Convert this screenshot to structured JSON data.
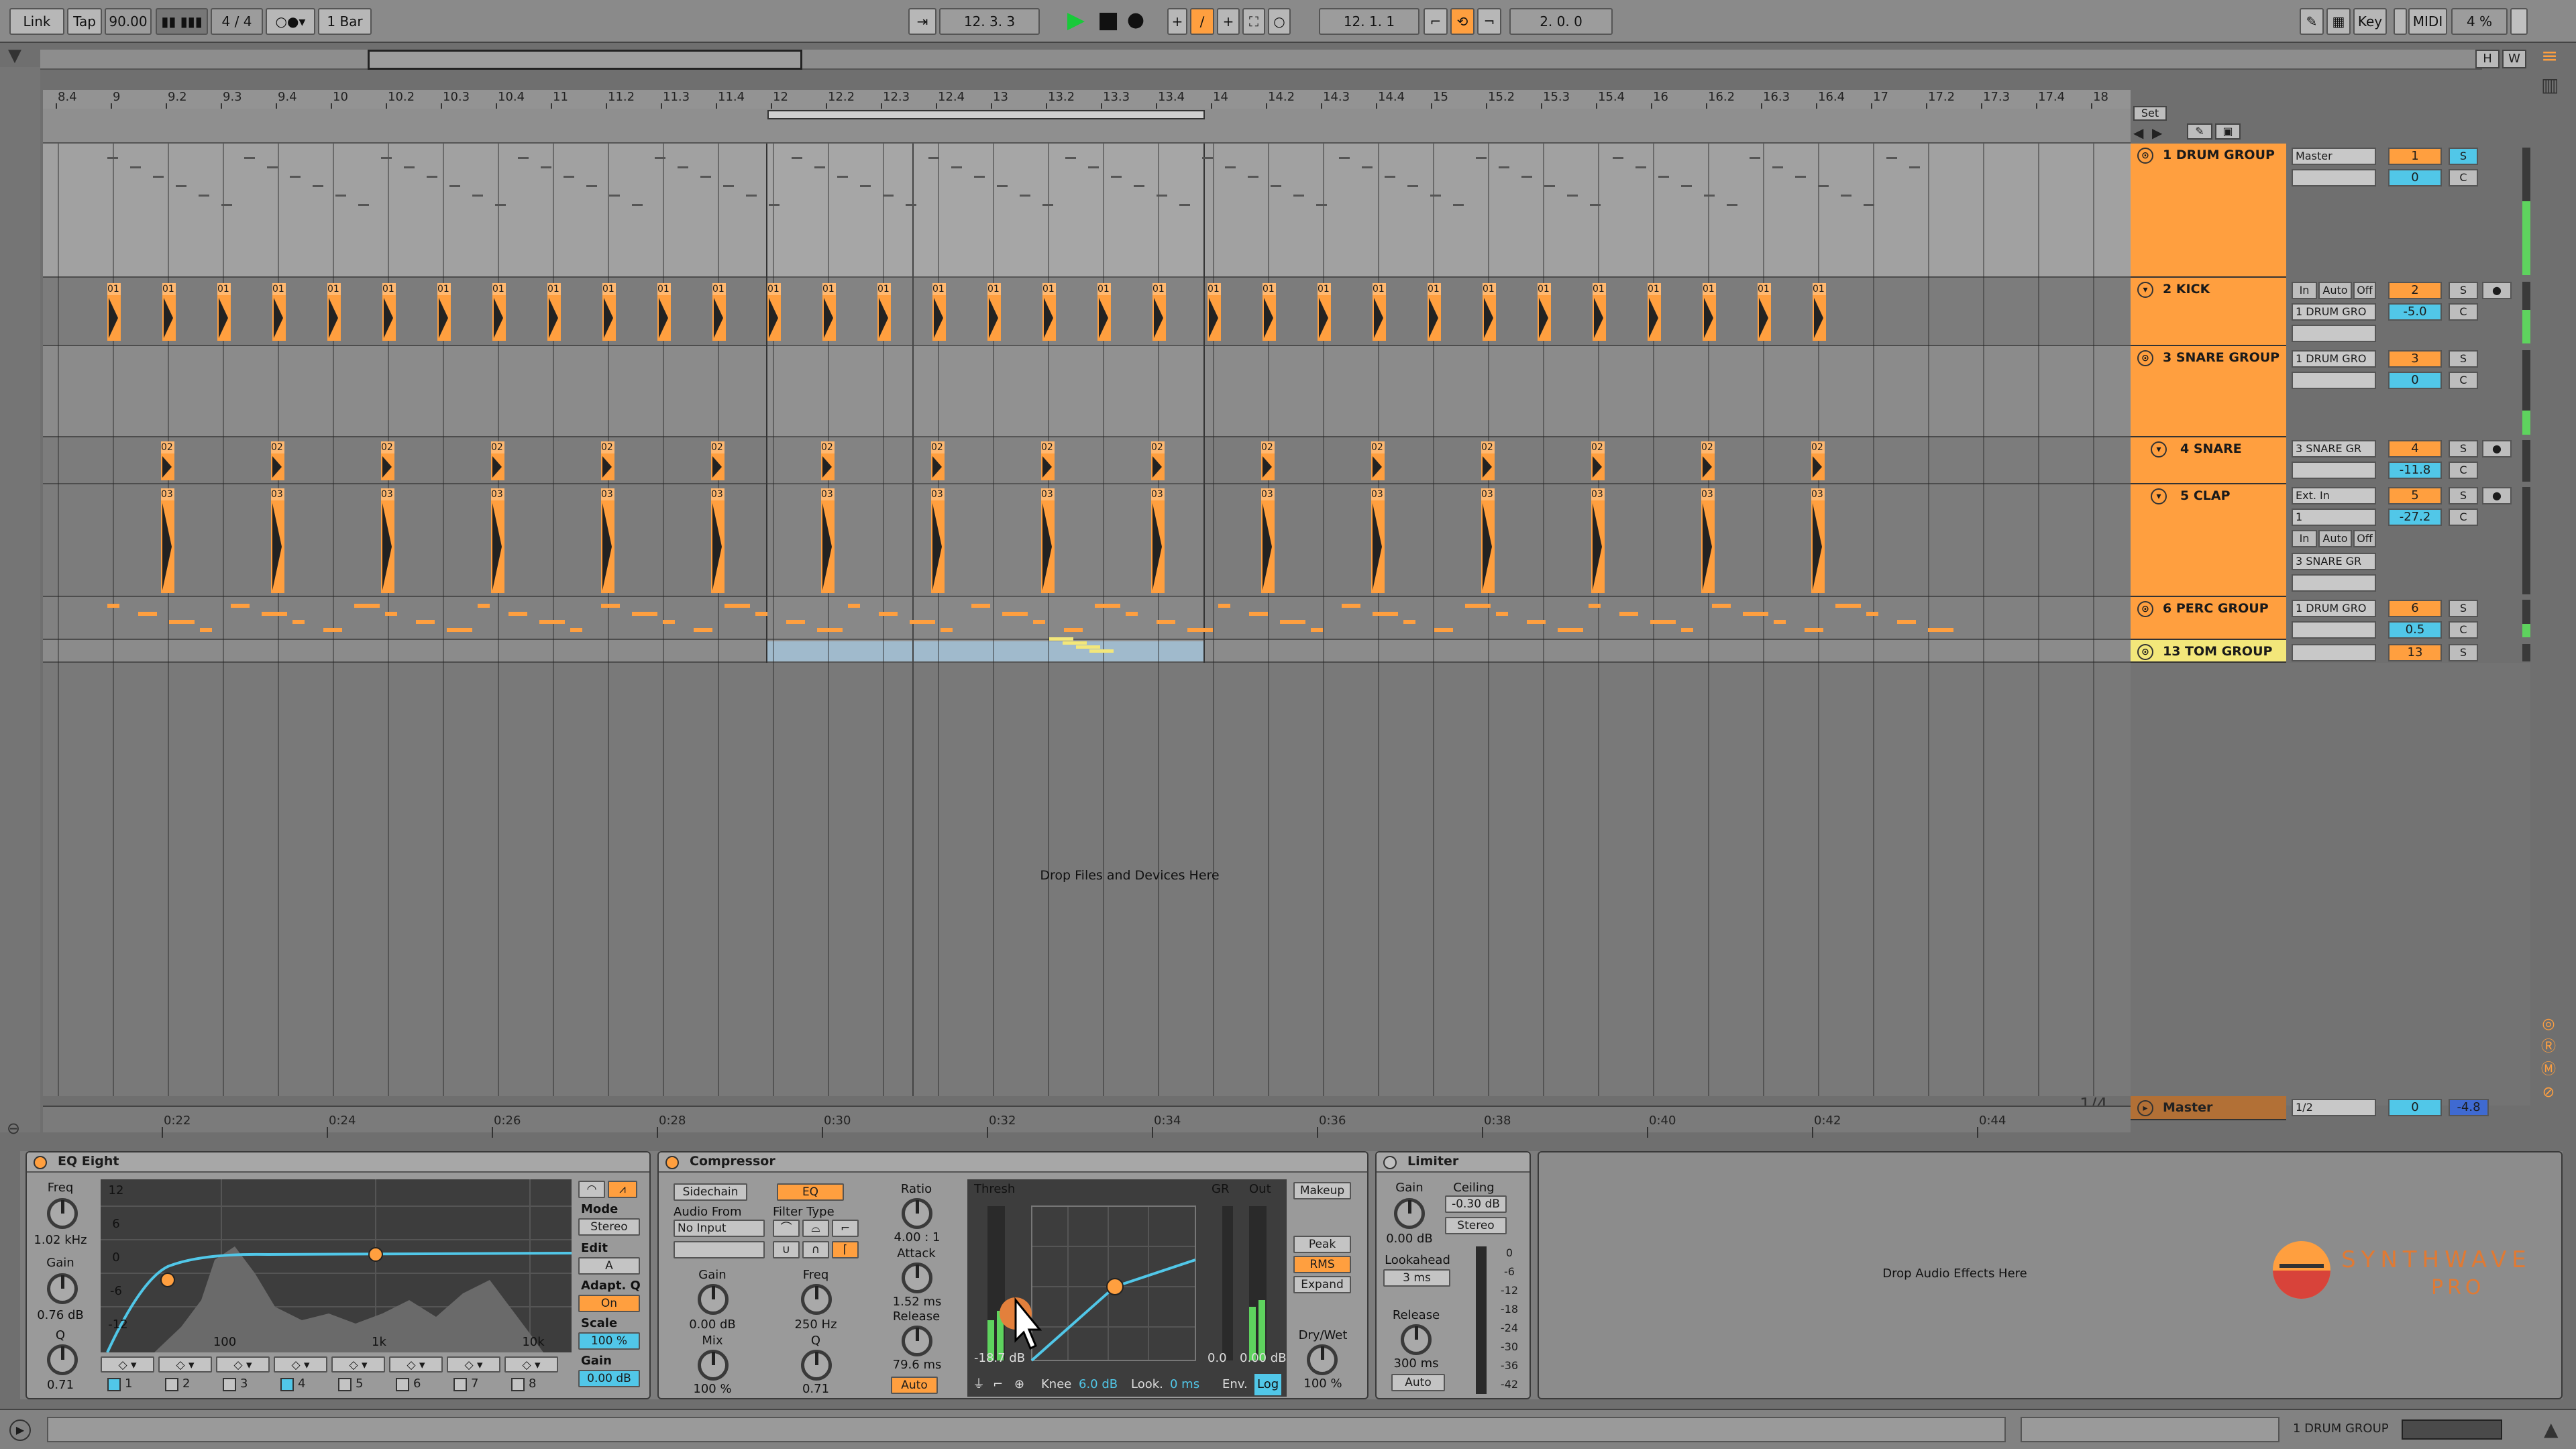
{
  "transport": {
    "link": "Link",
    "tap": "Tap",
    "tempo": "90.00",
    "time_sig": "4 / 4",
    "quantize": "1 Bar",
    "position": "12.  3.  3",
    "loop_start": "12.  1.  1",
    "loop_length": "2.  0.  0",
    "key": "Key",
    "midi": "MIDI",
    "cpu": "4 %",
    "hw_h": "H",
    "hw_w": "W"
  },
  "ruler_bars": [
    "8.4",
    "9",
    "9.2",
    "9.3",
    "9.4",
    "10",
    "10.2",
    "10.3",
    "10.4",
    "11",
    "11.2",
    "11.3",
    "11.4",
    "12",
    "12.2",
    "12.3",
    "12.4",
    "13",
    "13.2",
    "13.3",
    "13.4",
    "14",
    "14.2",
    "14.3",
    "14.4",
    "15",
    "15.2",
    "15.3",
    "15.4",
    "16",
    "16.2",
    "16.3",
    "16.4",
    "17",
    "17.2",
    "17.3",
    "17.4",
    "18"
  ],
  "time_ticks": [
    "0:22",
    "0:24",
    "0:26",
    "0:28",
    "0:30",
    "0:32",
    "0:34",
    "0:36",
    "0:38",
    "0:40",
    "0:42",
    "0:44"
  ],
  "set_label": "Set",
  "drop_files": "Drop Files and Devices Here",
  "drop_effects": "Drop Audio Effects Here",
  "page_count": "1/4",
  "tracks": [
    {
      "name": "1 DRUM GROUP",
      "input": "Master",
      "num": "1",
      "vol": "0",
      "solo": "S",
      "pan": "C",
      "color": "#ff9f3f"
    },
    {
      "name": "2 KICK",
      "input": "1 DRUM GRO",
      "num": "2",
      "vol": "-5.0",
      "solo": "S",
      "pan": "C",
      "mon_in": "In",
      "mon_auto": "Auto",
      "mon_off": "Off",
      "color": "#ff9f3f"
    },
    {
      "name": "3 SNARE GROUP",
      "input": "1 DRUM GRO",
      "num": "3",
      "vol": "0",
      "solo": "S",
      "pan": "C",
      "color": "#ff9f3f"
    },
    {
      "name": "4 SNARE",
      "input": "3 SNARE GR",
      "num": "4",
      "vol": "-11.8",
      "solo": "S",
      "pan": "C",
      "color": "#ff9f3f"
    },
    {
      "name": "5 CLAP",
      "input": "Ext. In",
      "input2": "1",
      "input3": "3 SNARE GR",
      "num": "5",
      "vol": "-27.2",
      "solo": "S",
      "pan": "C",
      "mon_in": "In",
      "mon_auto": "Auto",
      "mon_off": "Off",
      "color": "#ff9f3f"
    },
    {
      "name": "6 PERC GROUP",
      "input": "1 DRUM GRO",
      "num": "6",
      "vol": "0.5",
      "solo": "S",
      "pan": "C",
      "color": "#ff9f3f"
    },
    {
      "name": "13 TOM GROUP",
      "input": "",
      "num": "13",
      "vol": "",
      "solo": "S",
      "pan": "",
      "color": "#f3e77a"
    }
  ],
  "master": {
    "name": "Master",
    "input": "1/2",
    "vol": "0",
    "vol2": "-4.8"
  },
  "clip_labels": {
    "kick": "01",
    "snare": "02",
    "clap": "03"
  },
  "eq": {
    "title": "EQ Eight",
    "freq_label": "Freq",
    "freq_val": "1.02 kHz",
    "gain_label": "Gain",
    "gain_val": "0.76 dB",
    "q_label": "Q",
    "q_val": "0.71",
    "mode_label": "Mode",
    "mode_val": "Stereo",
    "edit_label": "Edit",
    "edit_val": "A",
    "adapt_label": "Adapt. Q",
    "adapt_val": "On",
    "scale_label": "Scale",
    "scale_val": "100 %",
    "outgain_label": "Gain",
    "outgain_val": "0.00 dB",
    "db_ticks": [
      "12",
      "6",
      "0",
      "-6",
      "-12"
    ],
    "freq_ticks": [
      "100",
      "1k",
      "10k"
    ],
    "bands": [
      "1",
      "2",
      "3",
      "4",
      "5",
      "6",
      "7",
      "8"
    ]
  },
  "comp": {
    "title": "Compressor",
    "sidechain": "Sidechain",
    "eq": "EQ",
    "audio_from": "Audio From",
    "no_input": "No Input",
    "filter_type": "Filter Type",
    "gain_label": "Gain",
    "gain_val": "0.00 dB",
    "mix_label": "Mix",
    "mix_val": "100 %",
    "freq_label": "Freq",
    "freq_val": "250 Hz",
    "q_label": "Q",
    "q_val": "0.71",
    "ratio_label": "Ratio",
    "ratio_val": "4.00 : 1",
    "attack_label": "Attack",
    "attack_val": "1.52 ms",
    "release_label": "Release",
    "release_val": "79.6 ms",
    "auto": "Auto",
    "thresh_label": "Thresh",
    "thresh_val": "-18.7 dB",
    "gr_label": "GR",
    "gr_val": "0.0",
    "out_label": "Out",
    "out_val": "0.00 dB",
    "makeup": "Makeup",
    "peak": "Peak",
    "rms": "RMS",
    "expand": "Expand",
    "drywet_label": "Dry/Wet",
    "drywet_val": "100 %",
    "knee_label": "Knee",
    "knee_val": "6.0 dB",
    "look_label": "Look.",
    "look_val": "0 ms",
    "env_label": "Env.",
    "env_val": "Log"
  },
  "limiter": {
    "title": "Limiter",
    "gain_label": "Gain",
    "gain_val": "0.00 dB",
    "ceiling_label": "Ceiling",
    "ceiling_val": "-0.30 dB",
    "stereo": "Stereo",
    "lookahead_label": "Lookahead",
    "lookahead_val": "3 ms",
    "release_label": "Release",
    "release_val": "300 ms",
    "auto": "Auto",
    "scale": [
      "0",
      "-6",
      "-12",
      "-18",
      "-24",
      "-30",
      "-36",
      "-42"
    ]
  },
  "brand": {
    "line1": "SYNTHWAVE",
    "line2": "PRO"
  },
  "status": {
    "track": "1 DRUM GROUP"
  }
}
